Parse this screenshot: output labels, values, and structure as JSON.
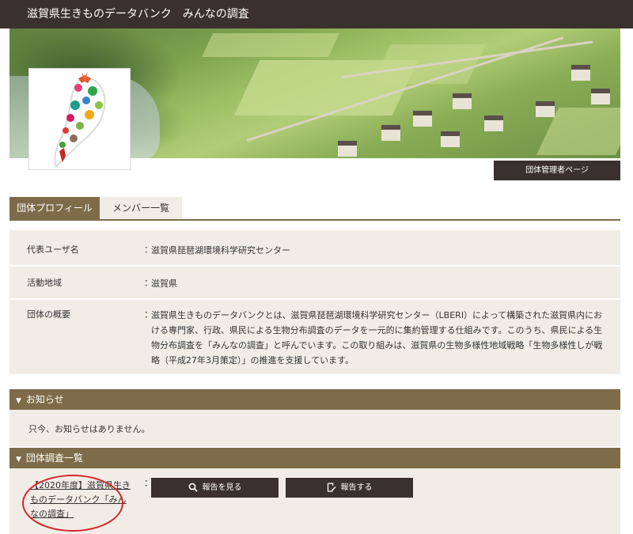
{
  "header": {
    "title": "滋賀県生きものデータバンク　みんなの調査"
  },
  "hero": {
    "admin_button": "団体管理者ページ"
  },
  "tabs": [
    {
      "label": "団体プロフィール",
      "active": true
    },
    {
      "label": "メンバー一覧",
      "active": false
    }
  ],
  "profile": {
    "rows": [
      {
        "label": "代表ユーザ名",
        "value": "滋賀県琵琶湖環境科学研究センター"
      },
      {
        "label": "活動地域",
        "value": "滋賀県"
      },
      {
        "label": "団体の概要",
        "value": "滋賀県生きものデータバンクとは、滋賀県琵琶湖環境科学研究センター（LBERI）によって構築された滋賀県内における専門家、行政、県民による生物分布調査のデータを一元的に集約管理する仕組みです。このうち、県民による生物分布調査を「みんなの調査」と呼んでいます。この取り組みは、滋賀県の生物多様性地域戦略「生物多様性しが戦略（平成27年3月策定）」の推進を支援しています。"
      }
    ],
    "colon": "："
  },
  "notices": {
    "title": "お知らせ",
    "empty_text": "只今、お知らせはありません。"
  },
  "surveys": {
    "title": "団体調査一覧",
    "items": [
      {
        "name": "【2020年度】滋賀県生きものデータバンク「みんなの調査」",
        "view_label": "報告を見る",
        "report_label": "報告する"
      }
    ]
  },
  "icons": {
    "section_toggle": "triangle-down-icon",
    "view": "search-icon",
    "report": "edit-document-icon"
  },
  "colors": {
    "header_bg": "#3a302d",
    "accent": "#7e6b49",
    "panel_bg": "#f1ede6",
    "annotation": "#d6252b"
  }
}
